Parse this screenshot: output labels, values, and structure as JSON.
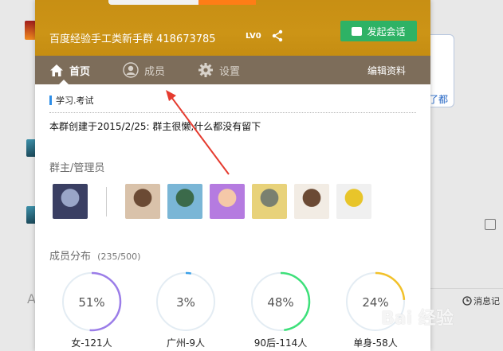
{
  "group": {
    "name": "百度经验手工类新手群 418673785",
    "level": "LV0",
    "chat_button": "发起会话"
  },
  "nav": {
    "home": "首页",
    "members": "成员",
    "settings": "设置",
    "edit": "编辑资料"
  },
  "tags": {
    "label": "学习.考试"
  },
  "intro": "本群创建于2015/2/25:  群主很懒,什么都没有留下",
  "admins": {
    "title": "群主/管理员",
    "avatars": [
      {
        "name": "avatar-owner-moon",
        "colors": [
          "#3a3f63",
          "#9aa6c8"
        ]
      },
      {
        "name": "avatar-admin-crying-child",
        "colors": [
          "#d9c2aa",
          "#6b4a34"
        ]
      },
      {
        "name": "avatar-admin-cartoon-sky",
        "colors": [
          "#7ab6d6",
          "#3b6a4a"
        ]
      },
      {
        "name": "avatar-admin-purple-girl",
        "colors": [
          "#b57be0",
          "#f5c8a8"
        ]
      },
      {
        "name": "avatar-admin-totoro",
        "colors": [
          "#e8d27a",
          "#7a8070"
        ]
      },
      {
        "name": "avatar-admin-girl-photo",
        "colors": [
          "#f2ece4",
          "#6b4a34"
        ]
      },
      {
        "name": "avatar-admin-minion",
        "colors": [
          "#f0f0f0",
          "#e8c52a"
        ]
      }
    ]
  },
  "distribution": {
    "title": "成员分布",
    "count": "(235/500)",
    "rings": [
      {
        "percent": "51%",
        "fraction": 0.51,
        "color": "#9b7de8",
        "label": "女-121人"
      },
      {
        "percent": "3%",
        "fraction": 0.03,
        "color": "#3aa0e8",
        "label": "广州-9人"
      },
      {
        "percent": "48%",
        "fraction": 0.48,
        "color": "#3ee07a",
        "label": "90后-114人"
      },
      {
        "percent": "24%",
        "fraction": 0.24,
        "color": "#f2c12a",
        "label": "单身-58人"
      }
    ]
  },
  "background": {
    "bubble_text": "了都",
    "bottom_right": "消息记"
  }
}
